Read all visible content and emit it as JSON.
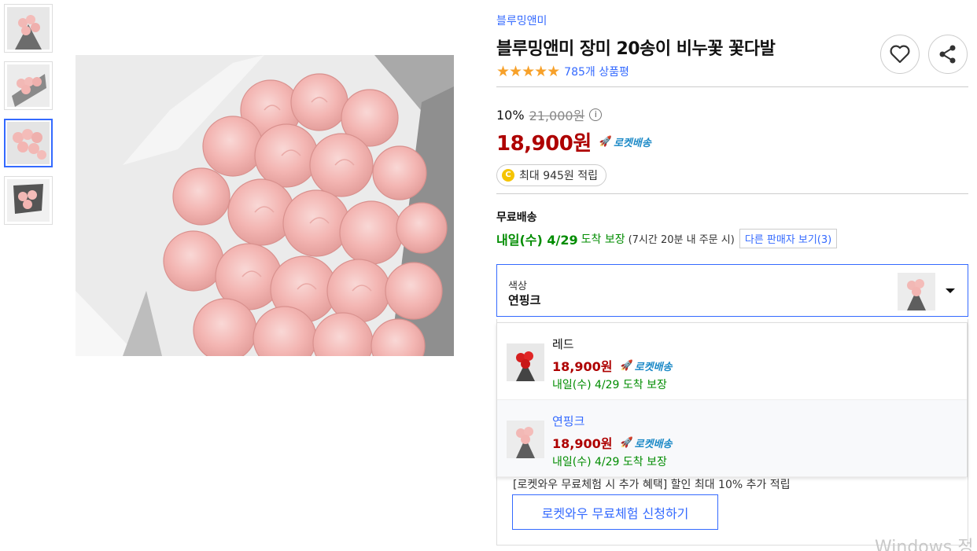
{
  "thumbnails": [
    {
      "name": "thumb-1"
    },
    {
      "name": "thumb-2"
    },
    {
      "name": "thumb-3",
      "active": true
    },
    {
      "name": "thumb-4"
    }
  ],
  "product": {
    "brand": "블루밍앤미",
    "title": "블루밍앤미 장미 20송이 비누꽃 꽃다발",
    "rating_stars": "★★★★★",
    "reviews": "785개 상품평"
  },
  "price": {
    "discount_rate": "10%",
    "original": "21,000원",
    "info_icon": "i",
    "sale": "18,900원",
    "rocket_label": "로켓배송",
    "points": "최대 945원 적립",
    "coin_icon": "C"
  },
  "shipping": {
    "label": "무료배송",
    "date": "내일(수) 4/29",
    "guarantee": "도착 보장",
    "time_note": "(7시간 20분 내 주문 시)",
    "other_sellers": "다른 판매자 보기(3)"
  },
  "option": {
    "label": "색상",
    "value": "연핑크"
  },
  "dropdown": {
    "items": [
      {
        "name": "레드",
        "price": "18,900원",
        "rocket": "로켓배송",
        "ship": "내일(수) 4/29 도착 보장"
      },
      {
        "name": "연핑크",
        "price": "18,900원",
        "rocket": "로켓배송",
        "ship": "내일(수) 4/29 도착 보장"
      }
    ]
  },
  "rocketwow": {
    "hidden_text": "[로켓와우 무료체험 시 추가 혜택] 할인 최대 10% 추가 적립",
    "button": "로켓와우 무료체험 신청하기"
  },
  "watermark": "Windows 정",
  "colors": {
    "accent": "#346aff",
    "price_red": "#ae0000",
    "ship_green": "#008c00",
    "star": "#f7a12a",
    "rose_pink": "#f3b5b2"
  }
}
